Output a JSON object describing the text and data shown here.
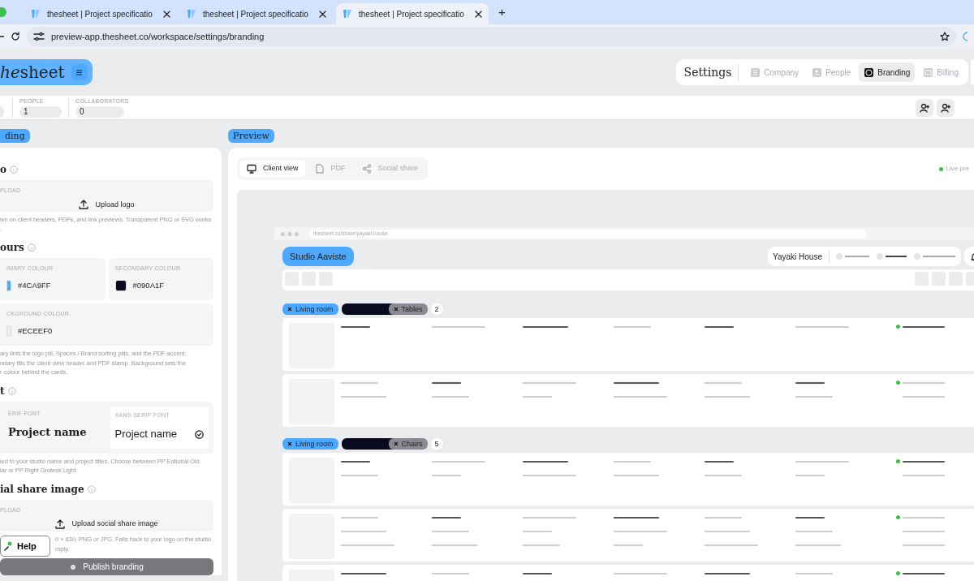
{
  "browser": {
    "tabs": [
      {
        "title": "thesheet | Project specificatio",
        "selected": false
      },
      {
        "title": "thesheet | Project specificatio",
        "selected": false
      },
      {
        "title": "thesheet | Project specificatio",
        "selected": true
      }
    ],
    "new_tab": "+",
    "url": "preview-app.thesheet.co/workspace/settings/branding"
  },
  "header": {
    "logo": {
      "italic": "he",
      "rest": "sheet"
    },
    "settings_nav": {
      "title": "Settings",
      "items": [
        {
          "label": "Company",
          "kind": "company",
          "selected": false
        },
        {
          "label": "People",
          "kind": "people",
          "selected": false
        },
        {
          "label": "Branding",
          "kind": "palette",
          "selected": true
        },
        {
          "label": "Billing",
          "kind": "card",
          "selected": false
        }
      ]
    }
  },
  "stats": [
    {
      "label": "PEOPLE",
      "value": "1"
    },
    {
      "label": "COLLABORATORS",
      "value": "0"
    }
  ],
  "branding": {
    "tag": "ding",
    "sections": [
      {
        "kind": "upload",
        "heading": "o",
        "label": "PLOAD",
        "button": "Upload logo",
        "hint": [
          "wn on client headers, PDFs, and link previews. Transparent PNG or SVG works",
          "."
        ]
      },
      {
        "kind": "colours",
        "heading": "ours",
        "colours": [
          {
            "label": "IMARY COLOUR",
            "value": "#4CA9FF",
            "color": "#4ca9ff"
          },
          {
            "label": "SECONDARY COLOUR",
            "value": "#090A1F",
            "color": "#090a1f"
          },
          {
            "label": "CKGROUND COLOUR",
            "value": "#ECEEF0",
            "color": "#eceef0"
          }
        ],
        "hint": [
          "ary tints the logo pill, Spaces / Brand sorting pills, and the PDF accent.",
          "ndary fills the client view header and PDF stamp. Background sets the",
          "r colour behind the cards."
        ]
      },
      {
        "kind": "fonts",
        "heading": "t",
        "fonts": [
          {
            "label": "ERIF FONT",
            "sample": "Project name",
            "kind": "serif",
            "selected": false
          },
          {
            "label": "SANS-SERIF FONT",
            "sample": "Project name",
            "kind": "sans",
            "selected": true
          }
        ],
        "hint": [
          "ied to your studio name and project titles. Choose between PP Editorial Old",
          "lar or PP Right Grotesk Light."
        ]
      },
      {
        "kind": "upload",
        "heading": "ial share image",
        "label": "PLOAD",
        "button": "Upload social share image",
        "hint": [
          "0 × 630, PNG or JPG. Falls back to your logo on the studio",
          "mpty."
        ]
      }
    ],
    "publish": "Publish branding",
    "help": "Help"
  },
  "preview": {
    "tag": "Preview",
    "tabs": [
      {
        "label": "Client view",
        "kind": "monitor",
        "selected": true
      },
      {
        "label": "PDF",
        "kind": "file",
        "selected": false
      },
      {
        "label": "Social share",
        "kind": "share",
        "selected": false
      }
    ],
    "live": "Live pre",
    "mockup": {
      "url": "thesheet.co/share/yayaki-house",
      "studio": "Studio Aaviste",
      "project": "Yayaki House",
      "groups": [
        {
          "tags": [
            {
              "label": "Living room",
              "kind": "space"
            },
            {
              "kind": "brand"
            },
            {
              "label": "Tables",
              "kind": "category"
            }
          ],
          "count": "2",
          "rows": [
            {
              "kind": "item"
            },
            {
              "kind": "item"
            }
          ]
        },
        {
          "tags": [
            {
              "label": "Living room",
              "kind": "space"
            },
            {
              "kind": "brand"
            },
            {
              "label": "Chairs",
              "kind": "category"
            }
          ],
          "count": "5",
          "rows": [
            {
              "kind": "item"
            },
            {
              "kind": "item"
            },
            {
              "kind": "item"
            }
          ]
        }
      ]
    }
  }
}
